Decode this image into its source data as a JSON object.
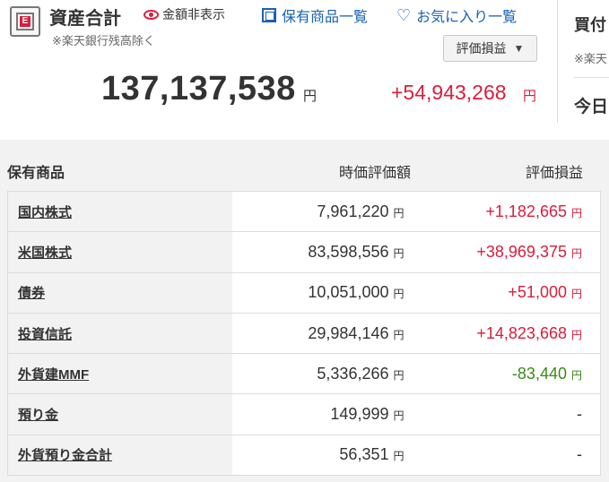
{
  "header": {
    "title": "資産合計",
    "hide_amount_label": "金額非表示",
    "note": "※楽天銀行残高除く",
    "link_holdings": "保有商品一覧",
    "link_favorites": "お気に入り一覧",
    "dropdown": {
      "selected": "評価損益",
      "arrow": "▼"
    },
    "total": "137,137,538",
    "total_unit": "円",
    "gain": "+54,943,268",
    "gain_unit": "円",
    "safe_mark": "E"
  },
  "side": {
    "buy_label": "買付",
    "note": "※楽天",
    "today_label": "今日"
  },
  "holdings": {
    "header_name": "保有商品",
    "header_value": "時価評価額",
    "header_gain": "評価損益",
    "unit": "円",
    "rows": [
      {
        "name": "国内株式",
        "value": "7,961,220",
        "gain": "+1,182,665",
        "gain_unit": "円",
        "tone": "pos"
      },
      {
        "name": "米国株式",
        "value": "83,598,556",
        "gain": "+38,969,375",
        "gain_unit": "円",
        "tone": "pos"
      },
      {
        "name": "債券",
        "value": "10,051,000",
        "gain": "+51,000",
        "gain_unit": "円",
        "tone": "pos"
      },
      {
        "name": "投資信託",
        "value": "29,984,146",
        "gain": "+14,823,668",
        "gain_unit": "円",
        "tone": "pos"
      },
      {
        "name": "外貨建MMF",
        "value": "5,336,266",
        "gain": "-83,440",
        "gain_unit": "円",
        "tone": "neg"
      },
      {
        "name": "預り金",
        "value": "149,999",
        "gain": "-",
        "gain_unit": "",
        "tone": "zero"
      },
      {
        "name": "外貨預り金合計",
        "value": "56,351",
        "gain": "-",
        "gain_unit": "",
        "tone": "zero"
      }
    ]
  },
  "colors": {
    "accent_red": "#d81e3c",
    "link_blue": "#1761b5",
    "loss_green": "#3a8a1a"
  }
}
